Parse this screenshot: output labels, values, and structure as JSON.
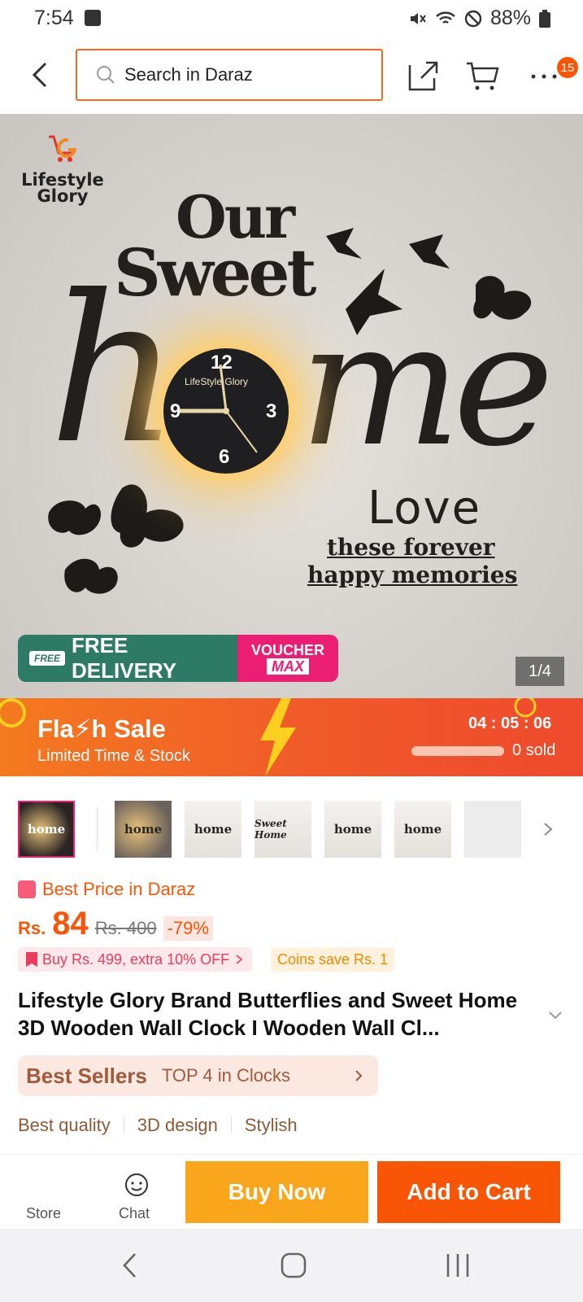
{
  "status_bar": {
    "time": "7:54",
    "battery": "88%"
  },
  "search": {
    "placeholder": "Search in Daraz"
  },
  "header": {
    "cart_badge": "15"
  },
  "hero": {
    "brand_line1": "Lifestyle",
    "brand_line2": "Glory",
    "word_our": "Our",
    "word_sweet": "Sweet",
    "word_h": "h",
    "word_me": "me",
    "clock_brand": "LifeStyle Glory",
    "clock_12": "12",
    "clock_3": "3",
    "clock_6": "6",
    "clock_9": "9",
    "word_love": "Love",
    "phrase1": "these forever",
    "phrase2": "happy memories",
    "free_badge": "FREE",
    "delivery_label": "FREE DELIVERY",
    "voucher_line1": "VOUCHER",
    "voucher_line2": "MAX",
    "pager": "1/4"
  },
  "flash_sale": {
    "title": "Fla⚡h Sale",
    "subtitle": "Limited Time & Stock",
    "countdown": "04 : 05 : 06",
    "sold": "0 sold"
  },
  "thumbnails": [
    {
      "label": "home"
    },
    {
      "label": "home"
    },
    {
      "label": "home"
    },
    {
      "label": "Sweet Home"
    },
    {
      "label": "home"
    },
    {
      "label": "home"
    },
    {
      "label": ""
    }
  ],
  "pricing": {
    "best_price_label": "Best Price in Daraz",
    "currency": "Rs.",
    "price": "84",
    "original": "Rs. 400",
    "discount": "-79%",
    "promo": "Buy Rs. 499, extra 10% OFF",
    "coins": "Coins save Rs. 1"
  },
  "product": {
    "title": "Lifestyle Glory Brand Butterflies and Sweet Home 3D Wooden Wall Clock I Wooden Wall Cl...",
    "best_sellers_label": "Best Sellers",
    "best_sellers_rank": "TOP 4 in Clocks",
    "tags": [
      "Best quality",
      "3D design",
      "Stylish"
    ]
  },
  "actions": {
    "store": "Store",
    "chat": "Chat",
    "buy_now": "Buy Now",
    "add_to_cart": "Add to Cart"
  }
}
